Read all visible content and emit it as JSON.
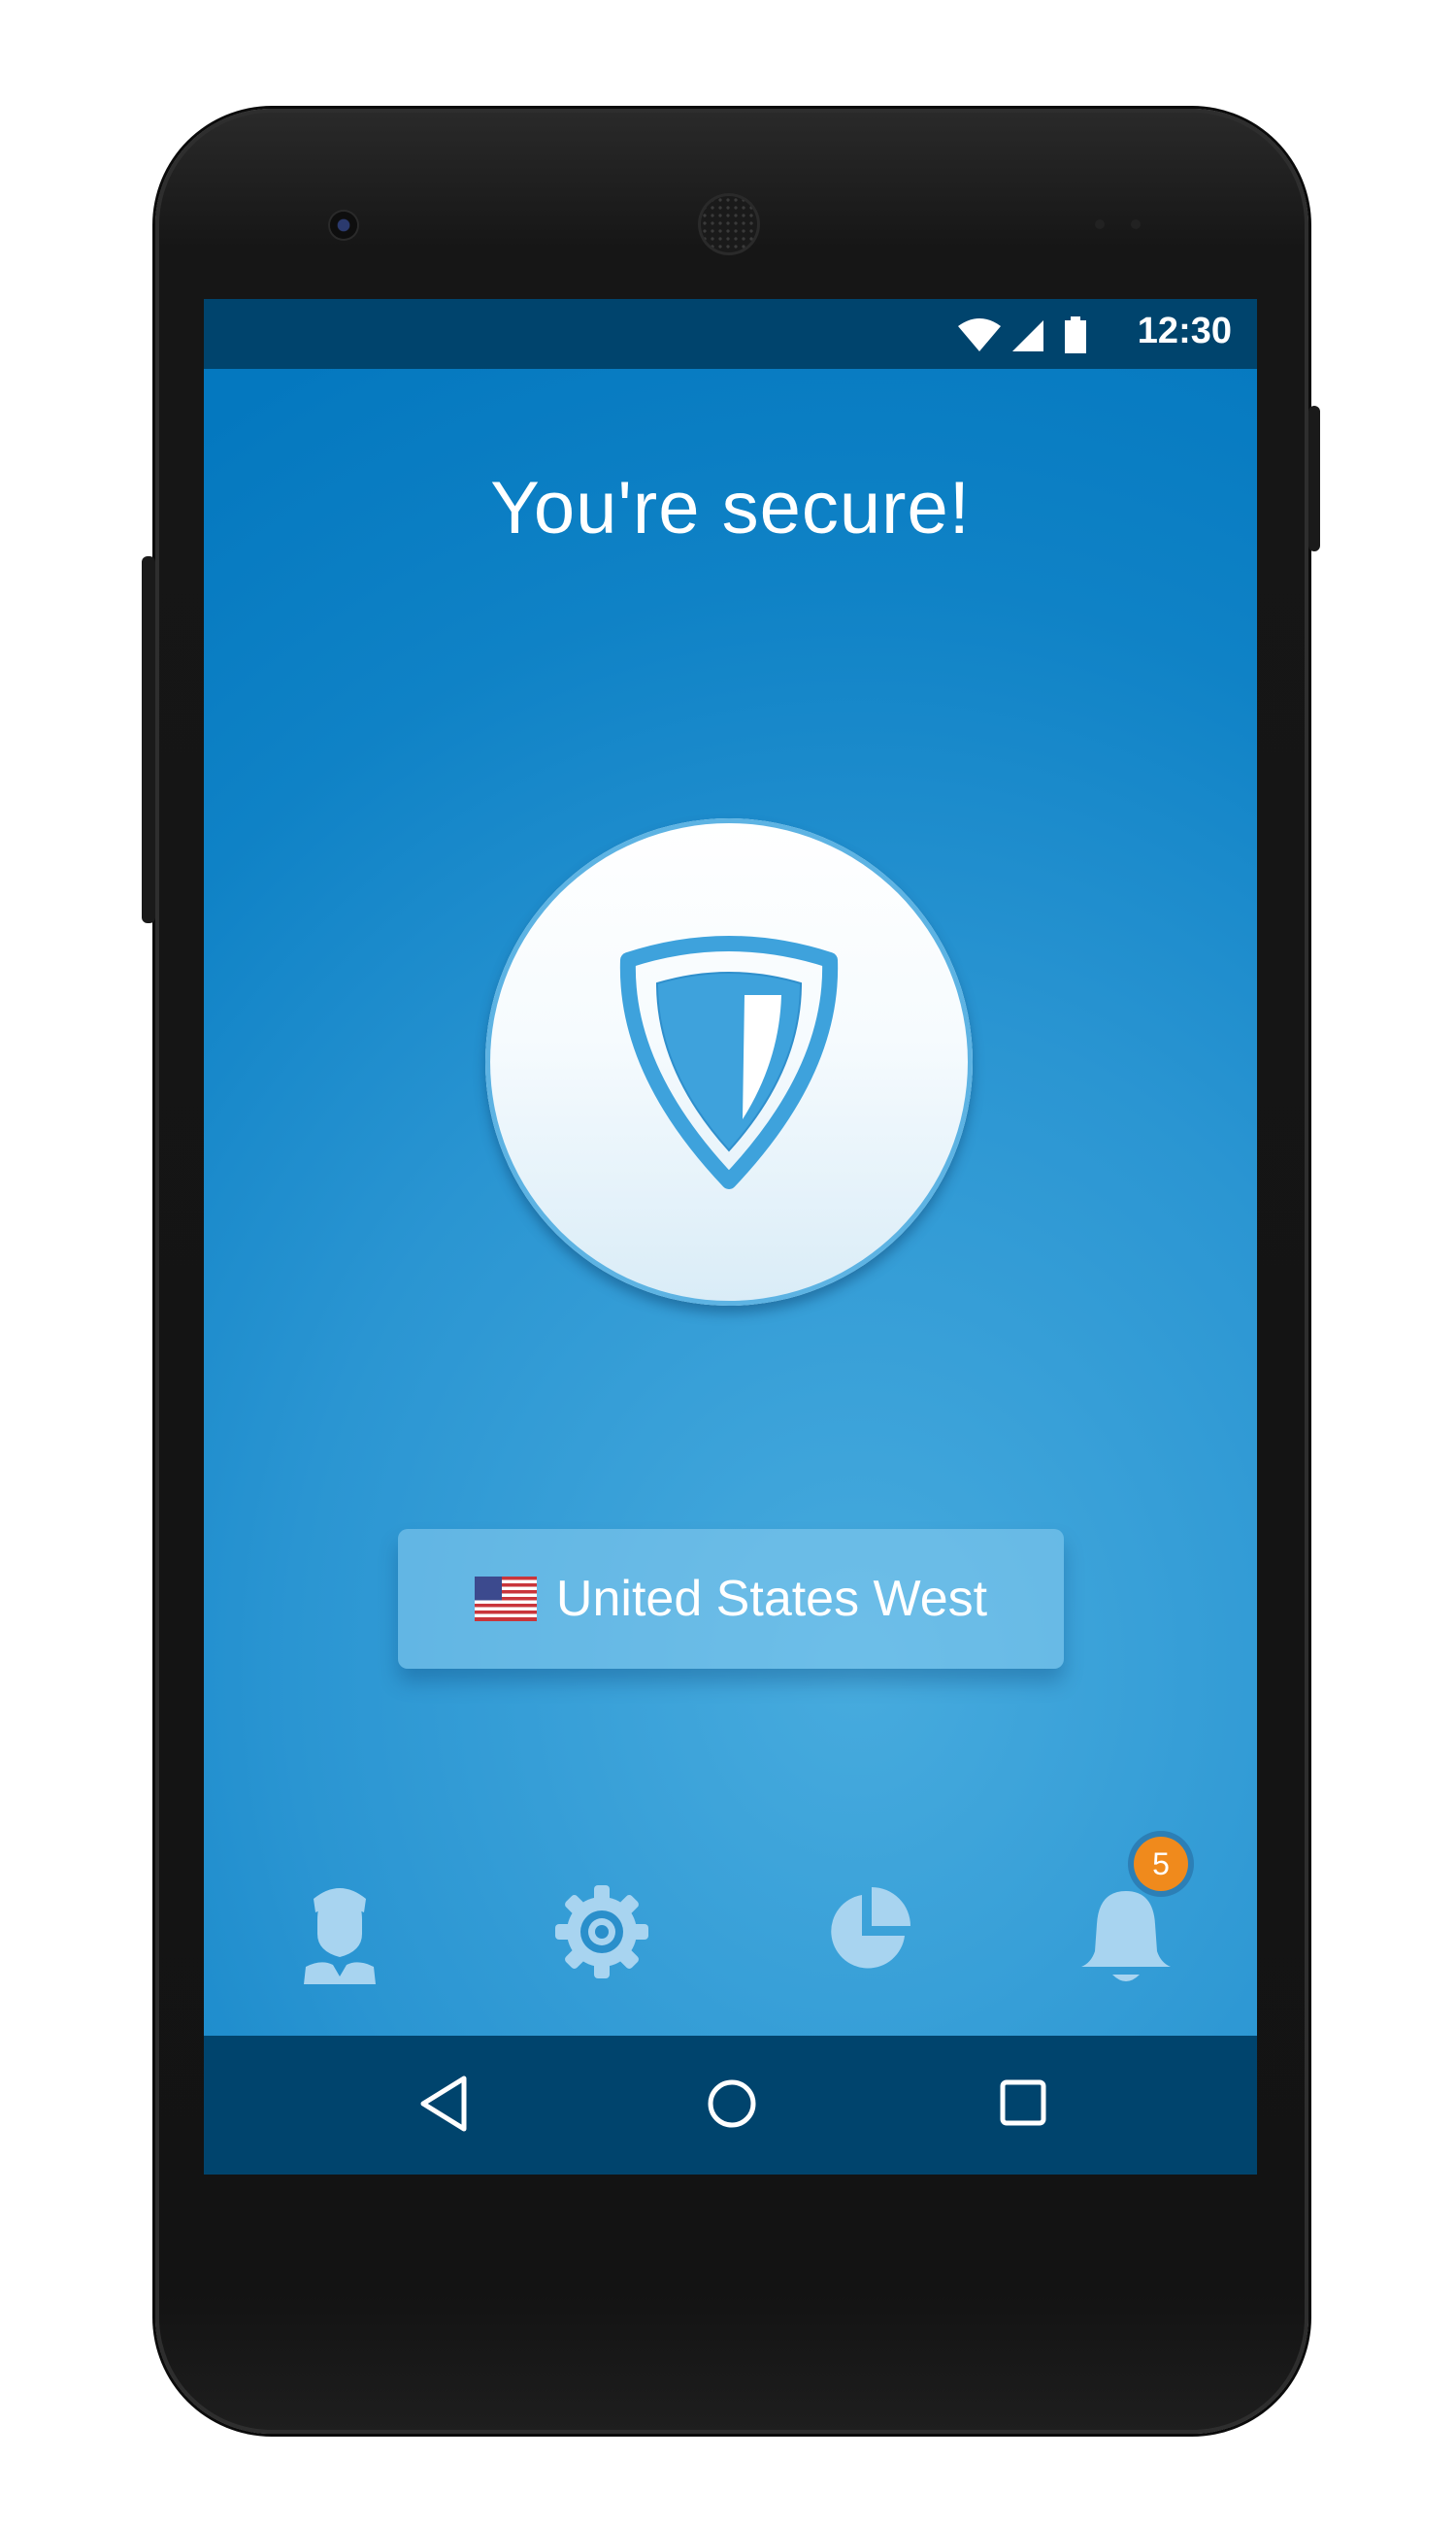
{
  "status_bar": {
    "time": "12:30",
    "icons": [
      "wifi-icon",
      "signal-icon",
      "battery-icon"
    ]
  },
  "app": {
    "title": "You're secure!",
    "shield_button_icon": "shield-icon",
    "location": {
      "flag_icon": "us-flag-icon",
      "label": "United States West"
    },
    "bottom_nav": [
      {
        "icon": "account-icon"
      },
      {
        "icon": "gear-icon"
      },
      {
        "icon": "pie-chart-icon"
      },
      {
        "icon": "bell-icon",
        "badge": "5"
      }
    ]
  },
  "system_nav": [
    "back-icon",
    "home-icon",
    "recents-icon"
  ],
  "colors": {
    "status_bar": "#00446d",
    "gradient_top": "#0478bf",
    "gradient_light": "#47abde",
    "badge": "#f08a1c",
    "nav_icon": "#a8d4f0"
  }
}
